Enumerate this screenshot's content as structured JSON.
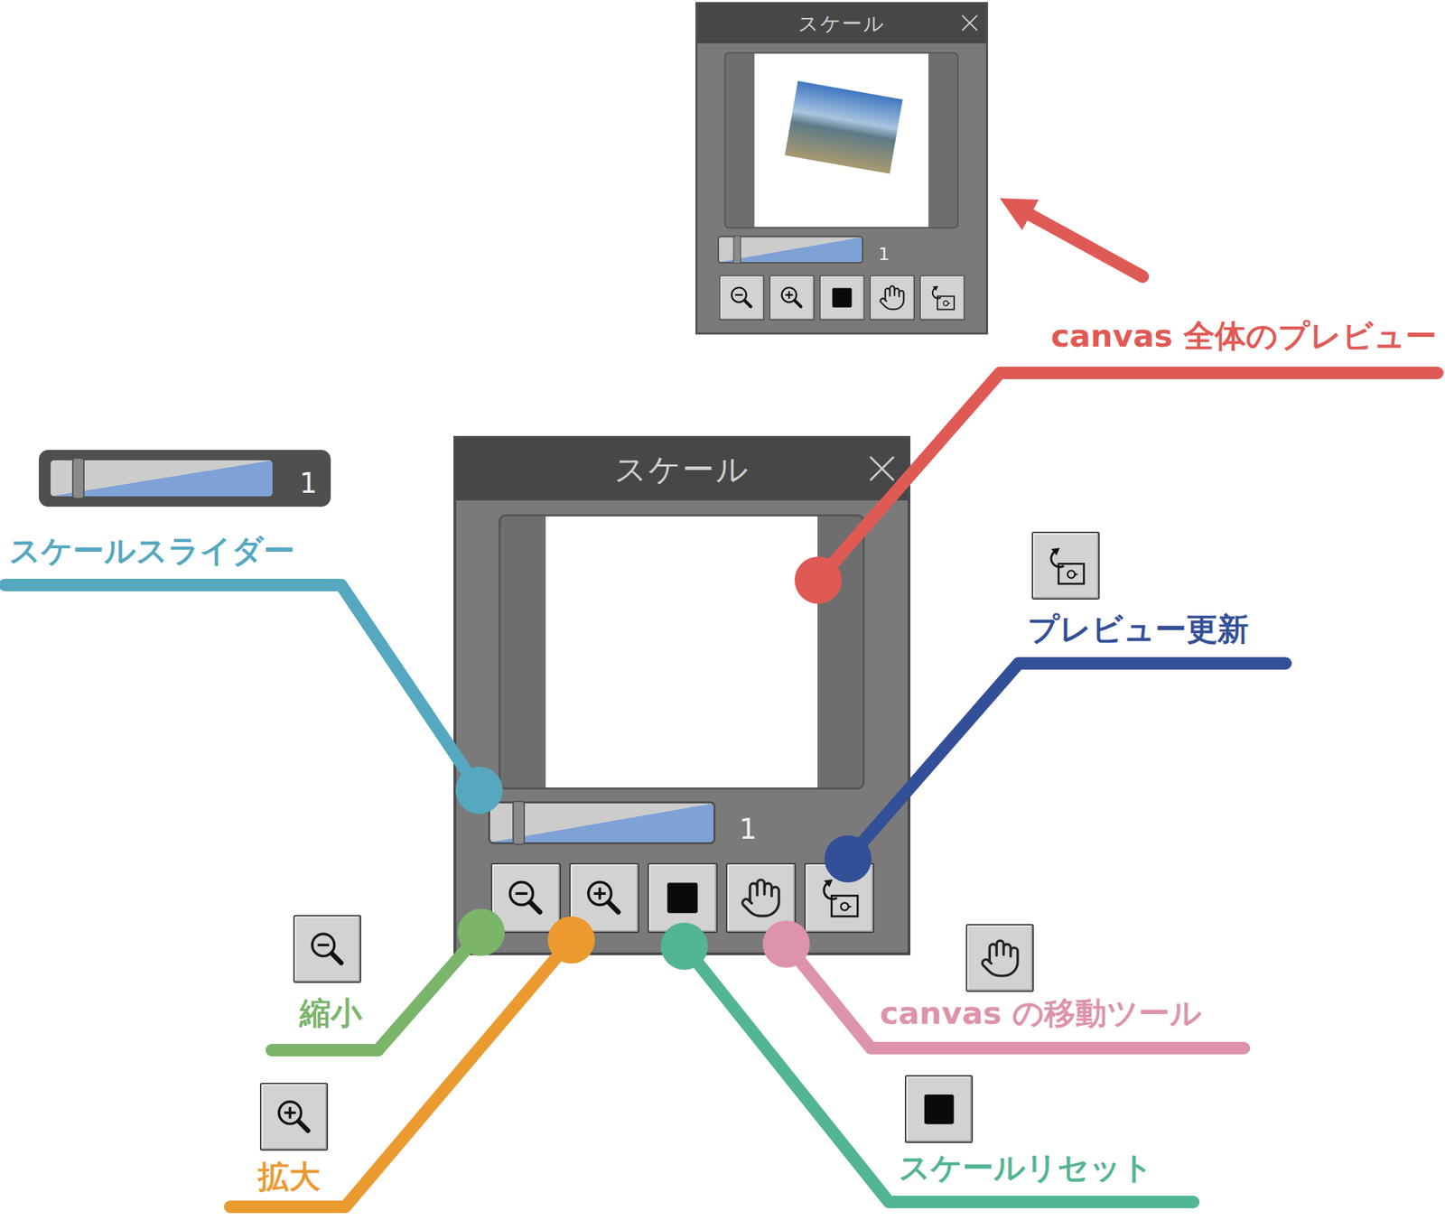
{
  "panels": [
    {
      "title": "スケール",
      "preview": {
        "kind": "photo"
      },
      "slider": {
        "level": 0.12,
        "reading": "1"
      },
      "buttons": [
        {
          "kind": "zoom-out"
        },
        {
          "kind": "zoom-in"
        },
        {
          "kind": "reset"
        },
        {
          "kind": "hand"
        },
        {
          "kind": "refresh"
        }
      ]
    },
    {
      "title": "スケール",
      "preview": {
        "kind": "blank"
      },
      "slider": {
        "level": 0.12,
        "reading": "1"
      },
      "buttons": [
        {
          "kind": "zoom-out"
        },
        {
          "kind": "zoom-in"
        },
        {
          "kind": "reset"
        },
        {
          "kind": "hand"
        },
        {
          "kind": "refresh"
        }
      ]
    }
  ],
  "callouts": [
    {
      "label": "canvas 全体のプレビュー",
      "color": "#e05a55",
      "kind": "preview"
    },
    {
      "label": "スケールスライダー",
      "color": "#55a8c0",
      "kind": "slider",
      "thumb": {
        "level": 0.12,
        "reading": "1"
      }
    },
    {
      "label": "縮小",
      "color": "#7ab56a",
      "kind": "zoom-out"
    },
    {
      "label": "拡大",
      "color": "#eb9a30",
      "kind": "zoom-in"
    },
    {
      "label": "スケールリセット",
      "color": "#52b593",
      "kind": "reset"
    },
    {
      "label": "canvas の移動ツール",
      "color": "#dd93ab",
      "kind": "hand"
    },
    {
      "label": "プレビュー更新",
      "color": "#334f98",
      "kind": "refresh"
    }
  ]
}
